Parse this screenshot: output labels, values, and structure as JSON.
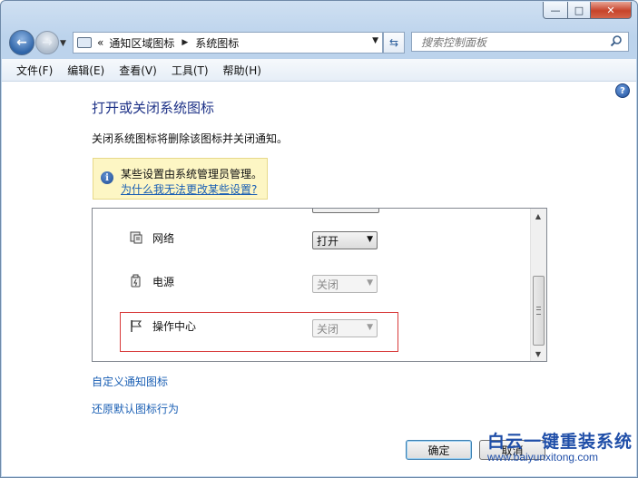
{
  "window": {
    "controls": {
      "minimize": "—",
      "maximize": "□",
      "close": "✕"
    }
  },
  "nav": {
    "breadcrumb": {
      "overflow": "«",
      "items": [
        "通知区域图标",
        "系统图标"
      ]
    },
    "search_placeholder": "搜索控制面板"
  },
  "menubar": {
    "items": [
      "文件(F)",
      "编辑(E)",
      "查看(V)",
      "工具(T)",
      "帮助(H)"
    ]
  },
  "content": {
    "title": "打开或关闭系统图标",
    "description": "关闭系统图标将删除该图标并关闭通知。",
    "info": {
      "text": "某些设置由系统管理员管理。",
      "link": "为什么我无法更改某些设置?"
    },
    "rows": [
      {
        "label": "网络",
        "value": "打开",
        "enabled": true,
        "icon": "network-icon"
      },
      {
        "label": "电源",
        "value": "关闭",
        "enabled": false,
        "icon": "power-icon"
      },
      {
        "label": "操作中心",
        "value": "关闭",
        "enabled": false,
        "icon": "action-center-flag-icon"
      }
    ],
    "links": [
      "自定义通知图标",
      "还原默认图标行为"
    ],
    "buttons": {
      "ok": "确定",
      "cancel": "取消"
    }
  },
  "watermark": {
    "title": "白云一键重装系统",
    "url": "www.baiyunxitong.com"
  },
  "colors": {
    "title_blue": "#1e3287",
    "link_blue": "#1a5fb4",
    "highlight_red": "#d83a3a",
    "info_bg": "#fdf6c4"
  }
}
